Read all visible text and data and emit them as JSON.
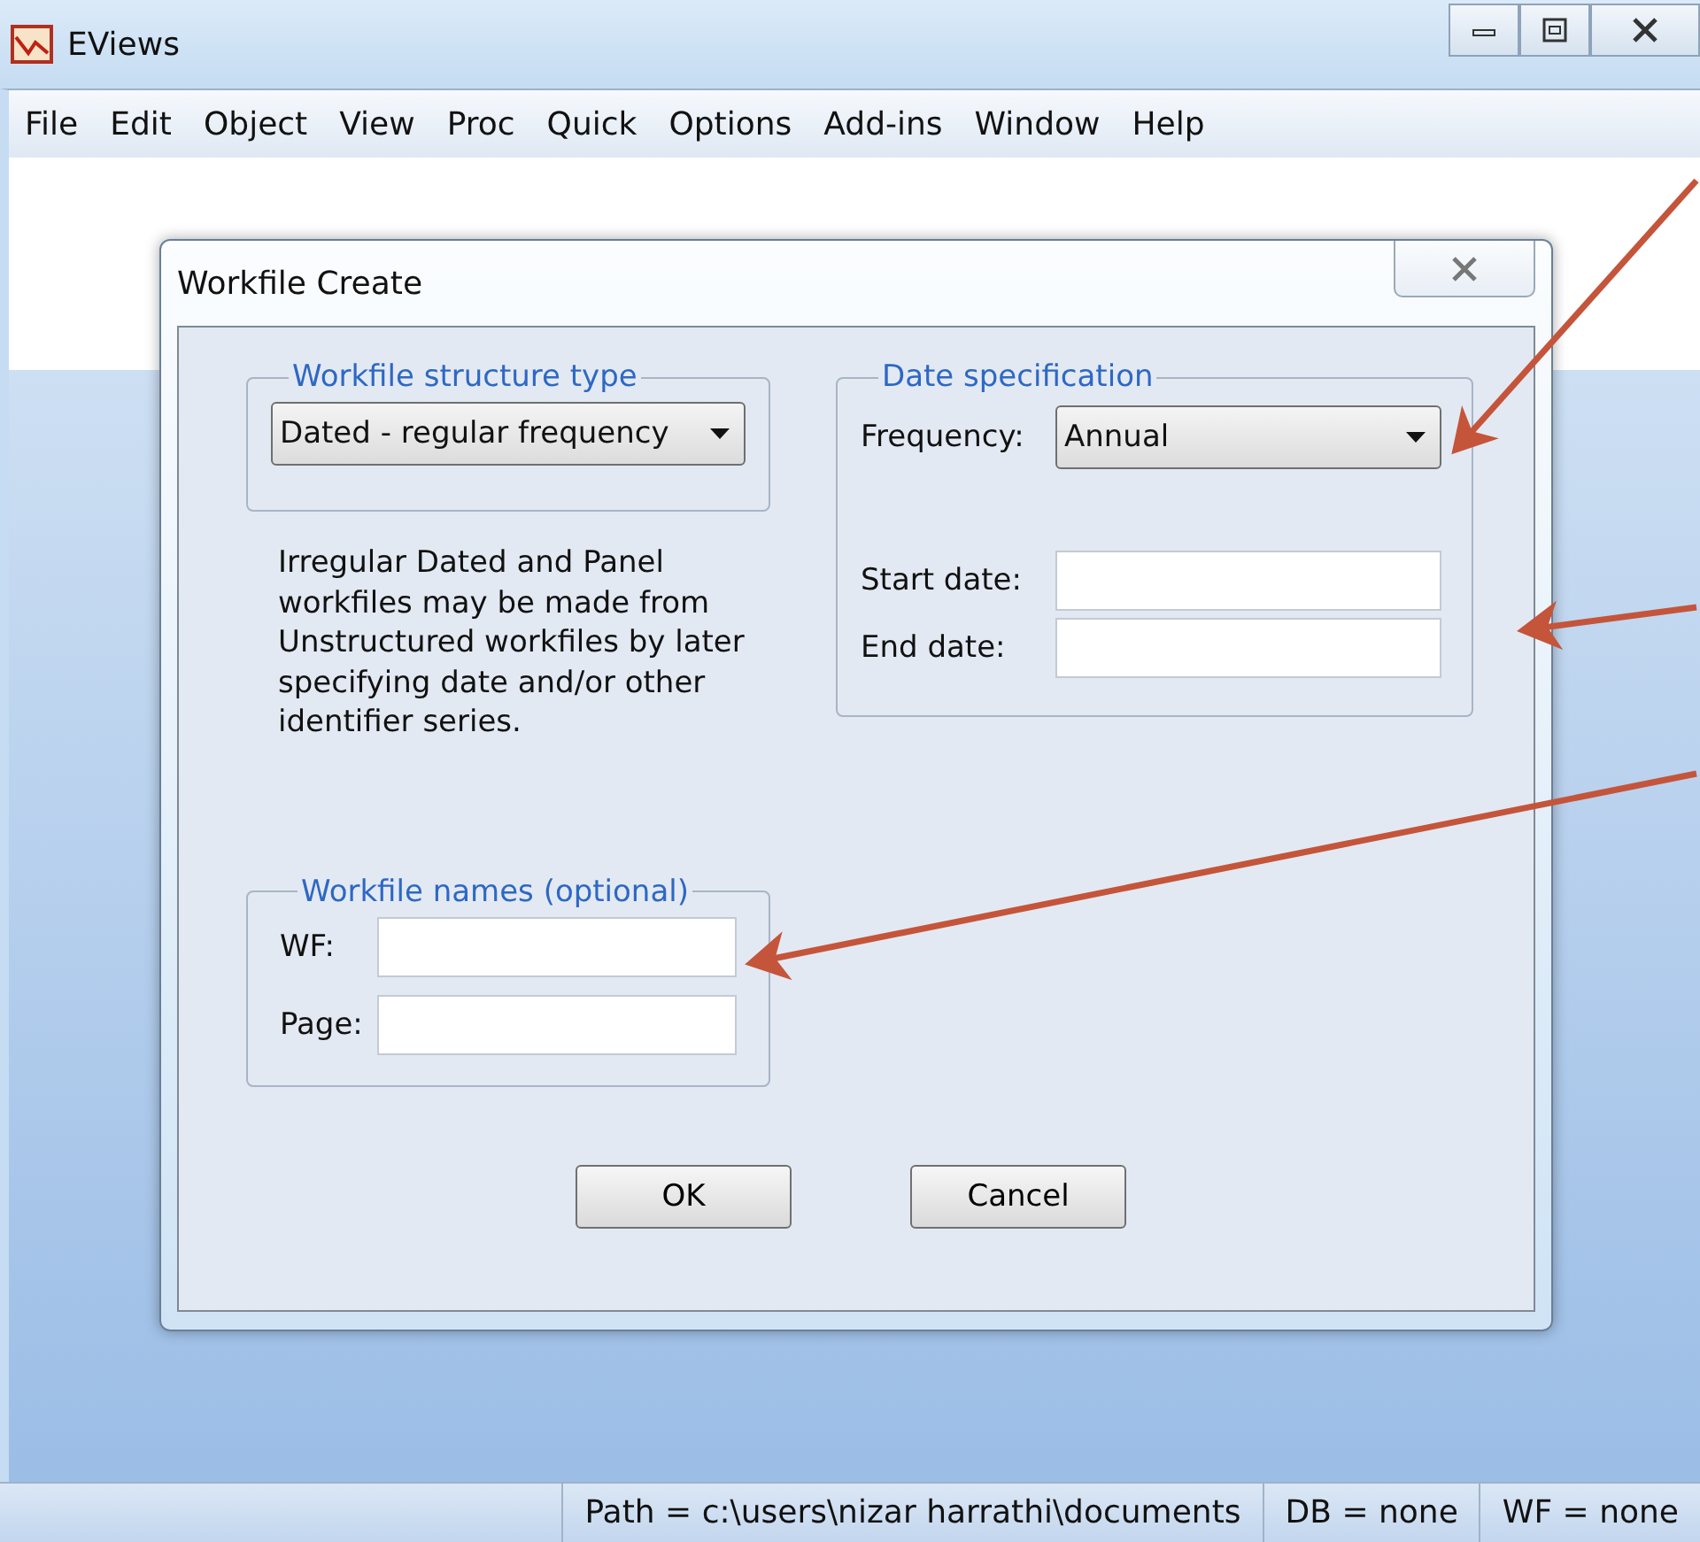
{
  "window": {
    "title": "EViews"
  },
  "menu": [
    "File",
    "Edit",
    "Object",
    "View",
    "Proc",
    "Quick",
    "Options",
    "Add-ins",
    "Window",
    "Help"
  ],
  "dialog": {
    "title": "Workfile Create",
    "structure": {
      "legend": "Workfile structure type",
      "value": "Dated - regular frequency"
    },
    "description": "Irregular Dated and Panel workfiles may be made from Unstructured workfiles by later specifying date and/or other identifier series.",
    "date_spec": {
      "legend": "Date specification",
      "frequency_label": "Frequency:",
      "frequency": "Annual",
      "start_label": "Start date:",
      "end_label": "End date:"
    },
    "names": {
      "legend": "Workfile names (optional)",
      "wf_label": "WF:",
      "page_label": "Page:"
    },
    "buttons": [
      "OK",
      "Cancel"
    ]
  },
  "status_bar": [
    "Path = c:\\users\\nizar harrathi\\documents",
    "DB = none",
    "WF = none"
  ]
}
